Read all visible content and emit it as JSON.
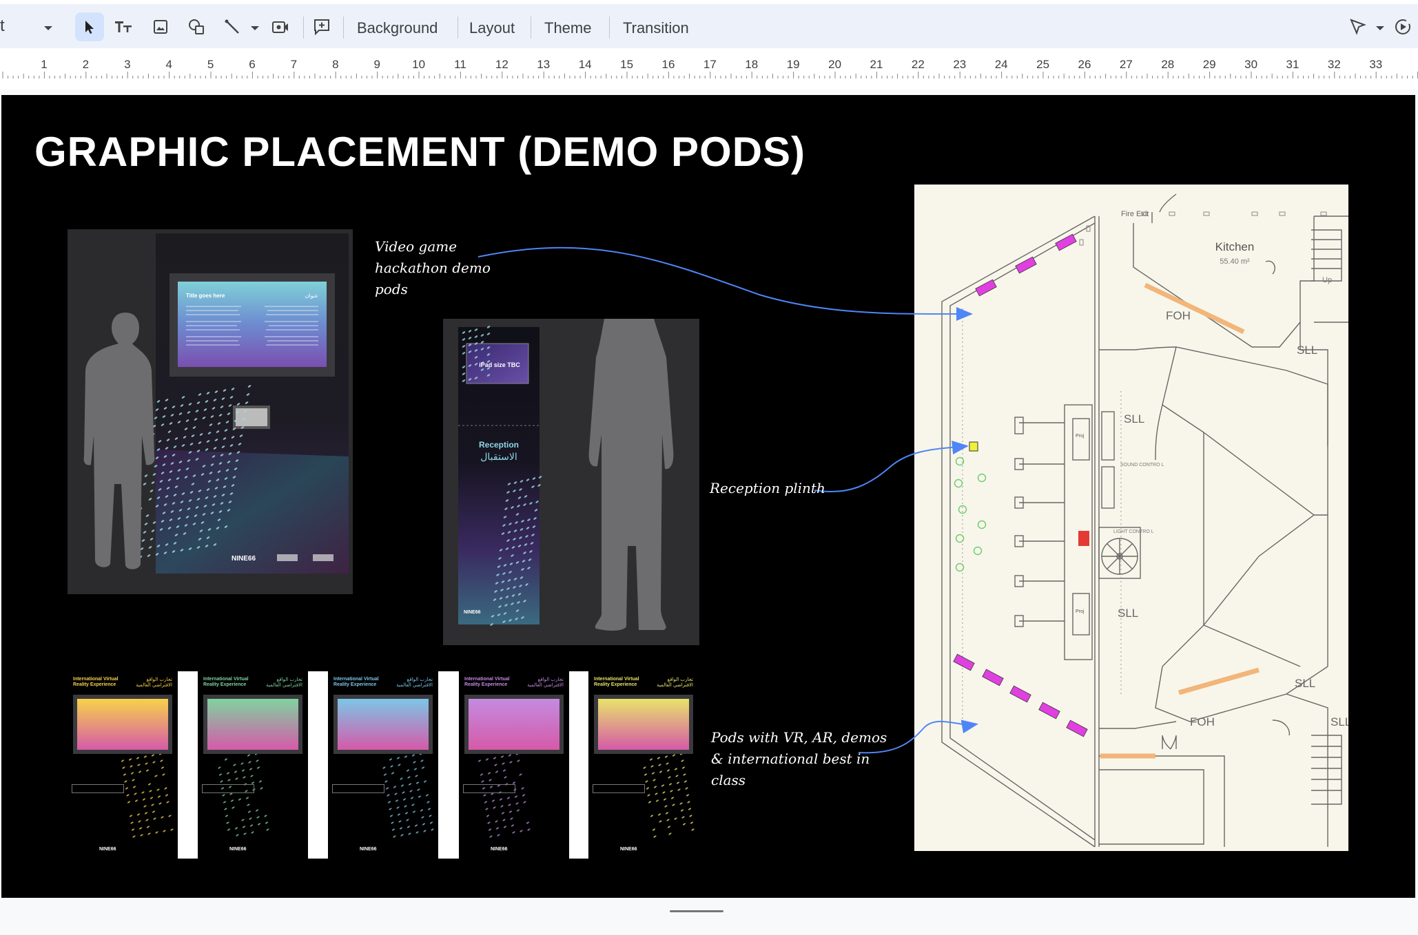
{
  "toolbar": {
    "zoom_label": "t",
    "menu": {
      "background": "Background",
      "layout": "Layout",
      "theme": "Theme",
      "transition": "Transition"
    },
    "icons": [
      "chevron-down-icon",
      "select-arrow-icon",
      "text-box-icon",
      "image-icon",
      "shape-icon",
      "line-icon",
      "chevron-down-icon",
      "video-icon",
      "comment-add-icon",
      "present-pointer-icon",
      "chevron-down-icon",
      "slideshow-icon"
    ]
  },
  "ruler": {
    "numbers": [
      "1",
      "2",
      "3",
      "4",
      "5",
      "6",
      "7",
      "8",
      "9",
      "10",
      "11",
      "12",
      "13",
      "14",
      "15",
      "16",
      "17",
      "18",
      "19",
      "20",
      "21",
      "22",
      "23",
      "24",
      "25",
      "26",
      "27",
      "28",
      "29",
      "30",
      "31",
      "32",
      "33"
    ]
  },
  "slide": {
    "title": "GRAPHIC PLACEMENT (DEMO PODS)",
    "annotations": {
      "video_game": [
        "Video game",
        "hackathon demo",
        "pods"
      ],
      "reception": [
        "Reception plinth"
      ],
      "pods_vr": [
        "Pods with VR, AR, demos",
        "& international best in",
        "class"
      ]
    },
    "mockup_pod": {
      "screen_title": "Title goes here",
      "screen_title_ar": "عنوان",
      "brand": "NINE66"
    },
    "mockup_reception": {
      "ipad_label": "iPad size TBC",
      "reception_en": "Reception",
      "reception_ar": "الاستقبال",
      "brand": "NINE66"
    },
    "posters": [
      {
        "title_en": "International Virtual Reality Experience",
        "title_ar": "تجارب الواقع الافتراضي العالمية",
        "brand": "NINE66",
        "accent": "#f7d24a"
      },
      {
        "title_en": "International Virtual Reality Experience",
        "title_ar": "تجارب الواقع الافتراضي العالمية",
        "brand": "NINE66",
        "accent": "#7fd3a0"
      },
      {
        "title_en": "International Virtual Reality Experience",
        "title_ar": "تجارب الواقع الافتراضي العالمية",
        "brand": "NINE66",
        "accent": "#7cc6e8"
      },
      {
        "title_en": "International Virtual Reality Experience",
        "title_ar": "تجارب الواقع الافتراضي العالمية",
        "brand": "NINE66",
        "accent": "#c48be0"
      },
      {
        "title_en": "International Virtual Reality Experience",
        "title_ar": "تجارب الواقع الافتراضي العالمية",
        "brand": "NINE66",
        "accent": "#e8e36a"
      }
    ],
    "floorplan": {
      "labels": {
        "fire_exit": "Fire Exit",
        "kitchen": "Kitchen",
        "kitchen_area": "55.40 m²",
        "up": "Up",
        "foh_top": "FOH",
        "sll_1": "SLL",
        "sll_2": "SLL",
        "sound_control": "SOUND CONTRO L",
        "light_control": "LIGHT CONTRO L",
        "sll_3": "SLL",
        "sll_4": "SLL",
        "foh_bottom": "FOH",
        "sll_5": "SLL",
        "proj_top": "Proj",
        "proj_bottom": "Proj"
      },
      "colors": {
        "pod": "#e040e0",
        "reception": "#f0f03a",
        "counter": "#f2b57a",
        "plant": "#6fcf6f",
        "marker": "#e53935"
      }
    }
  }
}
